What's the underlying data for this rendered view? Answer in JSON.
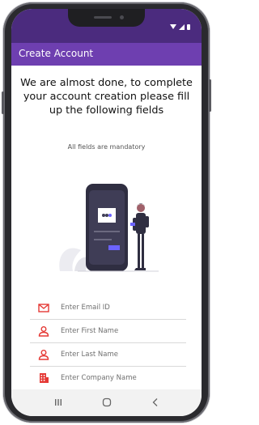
{
  "appbar": {
    "title": "Create Account"
  },
  "main": {
    "heading": "We are almost done, to complete your account creation please fill up the following fields",
    "subheading": "All fields are mandatory"
  },
  "form": {
    "fields": [
      {
        "placeholder": "Enter Email ID",
        "icon": "mail-icon"
      },
      {
        "placeholder": "Enter First Name",
        "icon": "person-icon"
      },
      {
        "placeholder": "Enter Last Name",
        "icon": "person-icon"
      },
      {
        "placeholder": "Enter Company Name",
        "icon": "building-icon"
      }
    ]
  },
  "navbar": {
    "icons": [
      "recent-apps-icon",
      "home-icon",
      "back-icon"
    ]
  },
  "colors": {
    "status_bar": "#4b2b7e",
    "app_bar": "#6e3fb0",
    "accent": "#e53935",
    "illustration_phone": "#2f2e41",
    "illustration_accent": "#6c63ff"
  }
}
